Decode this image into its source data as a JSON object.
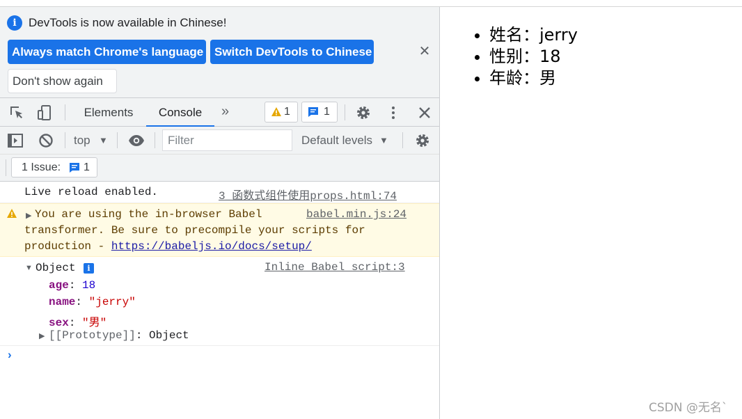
{
  "infobar": {
    "message": "DevTools is now available in Chinese!",
    "buttons": {
      "match": "Always match Chrome's language",
      "switch": "Switch DevTools to Chinese",
      "dismiss": "Don't show again"
    },
    "close_icon": "close-icon"
  },
  "tabs": {
    "items": [
      {
        "label": "Elements",
        "active": false
      },
      {
        "label": "Console",
        "active": true
      }
    ],
    "more_glyph": "»",
    "warnings_count": "1",
    "messages_count": "1"
  },
  "toolbar": {
    "context": "top",
    "filter_placeholder": "Filter",
    "filter_value": "",
    "levels": "Default levels"
  },
  "issues": {
    "label": "1 Issue:",
    "count": "1"
  },
  "console": {
    "messages": [
      {
        "text": "Live reload enabled.",
        "source": "3_函数式组件使用props.html:74"
      },
      {
        "level": "warning",
        "line1": "You are using the in-browser Babel",
        "line2": "transformer. Be sure to precompile your scripts for",
        "line3_prefix": "production - ",
        "link": "https://babeljs.io/docs/setup/",
        "source": "babel.min.js:24"
      },
      {
        "label": "Object",
        "source": "Inline Babel script:3",
        "props": [
          {
            "key": "age",
            "value": "18"
          },
          {
            "key": "name",
            "value": "\"jerry\""
          },
          {
            "key": "sex",
            "value": "\"男\""
          }
        ],
        "prototype_key": "[[Prototype]]",
        "prototype_value": "Object"
      }
    ],
    "prompt": "›"
  },
  "page": {
    "items": [
      "姓名：jerry",
      "性别：18",
      "年龄：男"
    ]
  },
  "watermark": "CSDN @无名`",
  "colors": {
    "accent": "#1a73e8",
    "warning_bg": "#fffbe5",
    "key": "#881280",
    "number": "#1c00cf",
    "string": "#c80000"
  }
}
